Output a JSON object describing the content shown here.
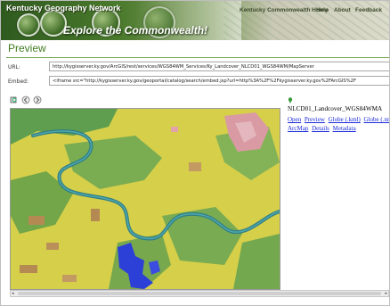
{
  "banner": {
    "title": "Kentucky Geography Network",
    "tagline": "Explore the Commonwealth!",
    "nav": [
      "Kentucky Commonwealth Home",
      "Help",
      "About",
      "Feedback"
    ]
  },
  "preview": {
    "heading": "Preview",
    "url_label": "URL:",
    "url_value": "http://kygisserver.ky.gov/ArcGIS/rest/services/WGS84WM_Services/Ky_Landcover_NLCD01_WGS84WM/MapServer",
    "embed_label": "Embed:",
    "embed_value": "<iframe src=\"http://kygisserver.ky.gov/geoportal/catalog/search/embed.jsp?url=http%3A%2F%2Fkygisserver.ky.gov%2FArcGIS%2F"
  },
  "toolbar": {
    "icons": [
      "zoom-icon",
      "back-icon",
      "forward-icon"
    ]
  },
  "layer": {
    "name": "NLCD01_Landcover_WGS84WMA",
    "links": [
      "Open",
      "Preview",
      "Globe (.kml)",
      "Globe (.nmf)",
      "ArcMap",
      "Details",
      "Metadata"
    ]
  },
  "colors": {
    "accent_green": "#3e7b1e",
    "link_blue": "#1a2bd8",
    "map_yellow": "#d8d04a",
    "river_teal": "#2f7f86",
    "water_blue": "#2c3fd6"
  }
}
